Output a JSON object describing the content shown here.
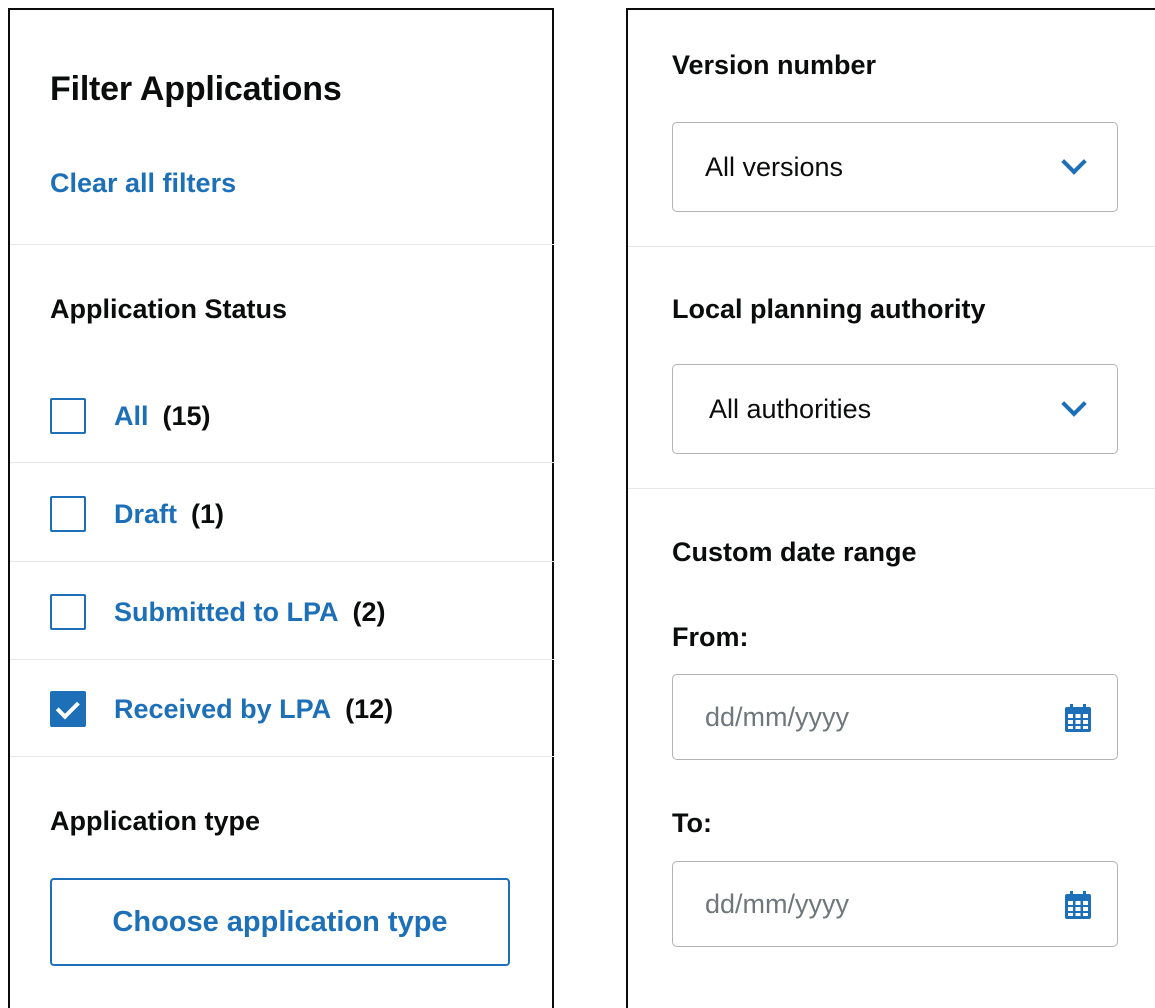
{
  "left": {
    "title": "Filter Applications",
    "clear_filters": "Clear all filters",
    "status_heading": "Application Status",
    "statuses": [
      {
        "label": "All",
        "count": "(15)",
        "checked": false
      },
      {
        "label": "Draft",
        "count": "(1)",
        "checked": false
      },
      {
        "label": "Submitted to LPA",
        "count": "(2)",
        "checked": false
      },
      {
        "label": "Received by LPA",
        "count": "(12)",
        "checked": true
      }
    ],
    "type_heading": "Application type",
    "type_button": "Choose application type"
  },
  "right": {
    "version_heading": "Version number",
    "version_value": "All versions",
    "lpa_heading": "Local planning authority",
    "lpa_value": "All authorities",
    "date_heading": "Custom date range",
    "from_label": "From:",
    "to_label": "To:",
    "date_placeholder": "dd/mm/yyyy"
  },
  "colors": {
    "link": "#1d70b8",
    "text": "#0b0c0c",
    "border": "#b1b4b6"
  },
  "icons": {
    "select": "chevron-down-icon",
    "date": "calendar-icon",
    "check": "checkmark-icon"
  }
}
